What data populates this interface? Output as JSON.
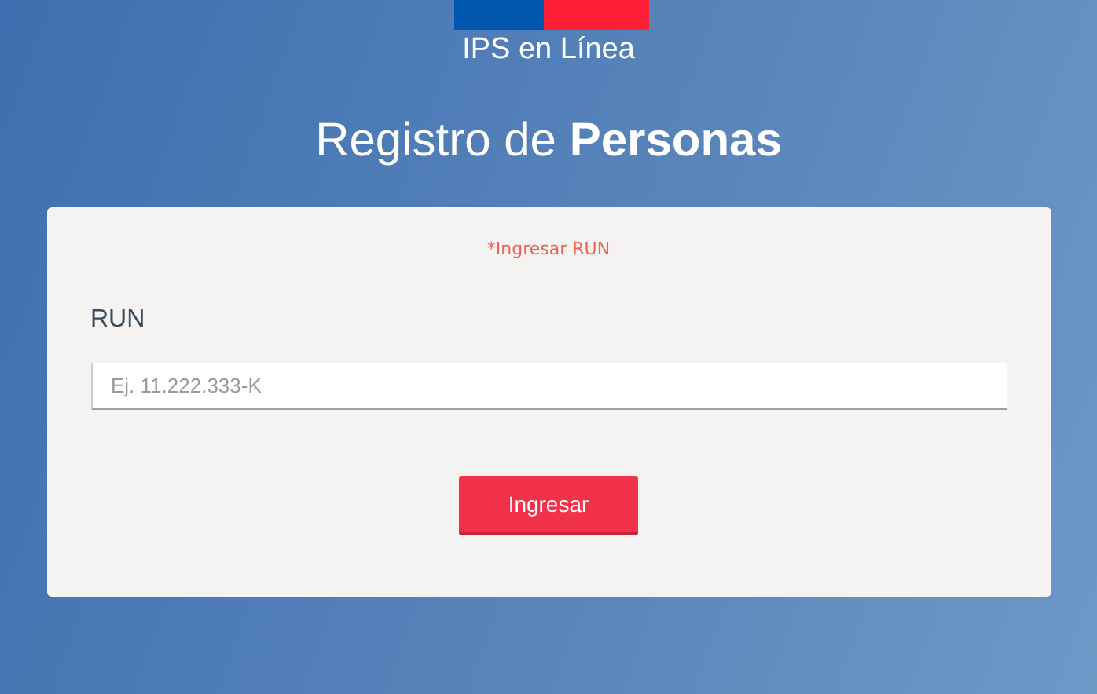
{
  "header": {
    "brand": "IPS en Línea",
    "heading": "Registro de **Personas**"
  },
  "form": {
    "error": "*Ingresar RUN",
    "label": "RUN",
    "placeholder": "Ej. 11.222.333-K",
    "button": "Ingresar"
  }
}
